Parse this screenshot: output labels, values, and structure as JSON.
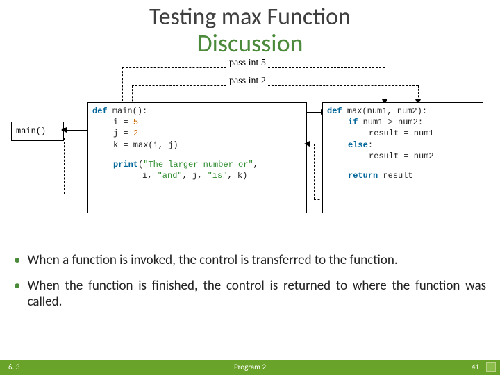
{
  "title": {
    "line1": "Testing max Function",
    "line2": "Discussion"
  },
  "flow": {
    "pass5": "pass int 5",
    "pass2": "pass int 2"
  },
  "call": {
    "text": "main()"
  },
  "main_fn": {
    "def": "def",
    "name": "main",
    "sig": "():",
    "l1a": "i =",
    "l1b": "5",
    "l2a": "j =",
    "l2b": "2",
    "l3": "k = max(i, j)",
    "printkw": "print",
    "po": "(",
    "s1": "\"The larger number or\"",
    "c1": ",",
    "arg_i": "i",
    "c2": ",",
    "s2": "\"and\"",
    "c3": ",",
    "arg_j": "j",
    "c4": ",",
    "s3": "\"is\"",
    "c5": ",",
    "arg_k": "k",
    "pc": ")"
  },
  "max_fn": {
    "def": "def",
    "name": "max",
    "sig": "(num1, num2):",
    "ifkw": "if",
    "cond": "num1 > num2:",
    "r1": "result = num1",
    "elsekw": "else",
    "colon": ":",
    "r2": "result = num2",
    "retkw": "return",
    "retv": "result"
  },
  "bullets": {
    "b1": "When a function is invoked, the control is transferred to the function.",
    "b2": "When the function is finished, the control is returned to where the function was called."
  },
  "footer": {
    "left": "6. 3",
    "mid": "Program 2",
    "right": "41"
  }
}
